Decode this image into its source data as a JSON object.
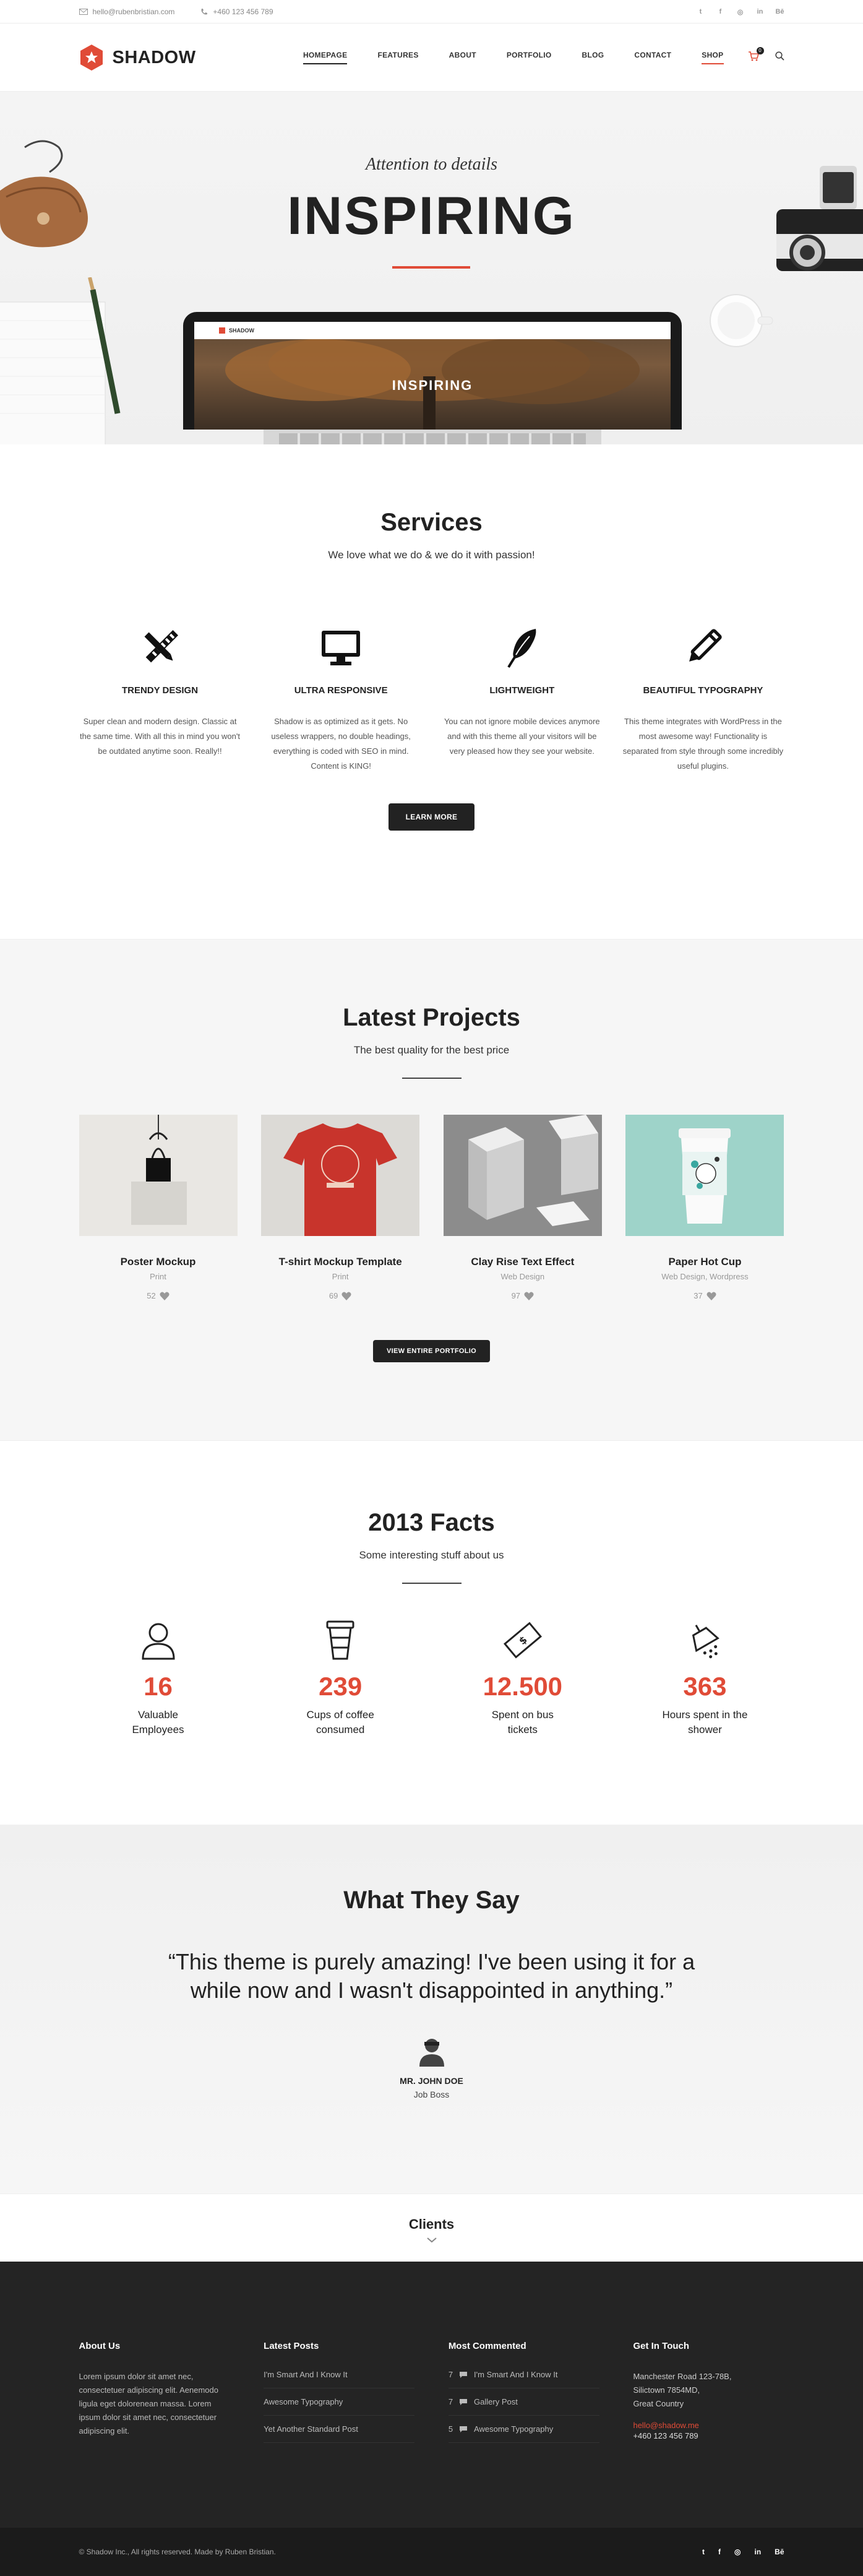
{
  "topbar": {
    "email": "hello@rubenbristian.com",
    "phone": "+460 123 456 789",
    "social": [
      "twitter-icon",
      "facebook-icon",
      "dribbble-icon",
      "linkedin-icon",
      "behance-icon"
    ]
  },
  "header": {
    "logo_text": "SHADOW",
    "nav": [
      "HOMEPAGE",
      "FEATURES",
      "ABOUT",
      "PORTFOLIO",
      "BLOG",
      "CONTACT",
      "SHOP"
    ],
    "cart_count": "0"
  },
  "hero": {
    "kicker": "Attention to details",
    "headline": "INSPIRING",
    "screen_logo": "SHADOW",
    "screen_text": "INSPIRING"
  },
  "services": {
    "title": "Services",
    "subtitle": "We love what we do & we do it with passion!",
    "items": [
      {
        "icon": "pencil-ruler-icon",
        "title": "TRENDY DESIGN",
        "text": "Super clean and modern design. Classic at the same time. With all this in mind you won't be outdated anytime soon. Really!!"
      },
      {
        "icon": "monitor-icon",
        "title": "ULTRA RESPONSIVE",
        "text": "Shadow is as optimized as it gets. No useless wrappers, no double headings, everything is coded with SEO in mind. Content is KING!"
      },
      {
        "icon": "feather-icon",
        "title": "LIGHTWEIGHT",
        "text": "You can not ignore mobile devices anymore and with this theme all your visitors will be very pleased how they see your website."
      },
      {
        "icon": "pen-icon",
        "title": "BEAUTIFUL TYPOGRAPHY",
        "text": "This theme integrates with WordPress in the most awesome way! Functionality is separated from style through some incredibly useful plugins."
      }
    ],
    "button": "LEARN MORE"
  },
  "projects": {
    "title": "Latest Projects",
    "subtitle": "The best quality for the best price",
    "items": [
      {
        "title": "Poster Mockup",
        "category": "Print",
        "likes": "52"
      },
      {
        "title": "T-shirt Mockup Template",
        "category": "Print",
        "likes": "69"
      },
      {
        "title": "Clay Rise Text Effect",
        "category": "Web Design",
        "likes": "97"
      },
      {
        "title": "Paper Hot Cup",
        "category": "Web Design, Wordpress",
        "likes": "37"
      }
    ],
    "button": "VIEW ENTIRE PORTFOLIO"
  },
  "facts": {
    "title": "2013 Facts",
    "subtitle": "Some interesting stuff about us",
    "items": [
      {
        "icon": "user-icon",
        "number": "16",
        "label": "Valuable Employees"
      },
      {
        "icon": "coffee-cup-icon",
        "number": "239",
        "label": "Cups of coffee consumed"
      },
      {
        "icon": "ticket-icon",
        "number": "12.500",
        "label": "Spent on bus tickets"
      },
      {
        "icon": "shower-icon",
        "number": "363",
        "label": "Hours spent in the shower"
      }
    ]
  },
  "testimonial": {
    "title": "What They Say",
    "quote": "“This theme is purely amazing! I've been using it for a while now and I wasn't disappointed in anything.”",
    "name": "MR. JOHN DOE",
    "role": "Job Boss"
  },
  "clients": {
    "title": "Clients"
  },
  "footer": {
    "about": {
      "title": "About Us",
      "text": "Lorem ipsum dolor sit amet nec, consectetuer adipiscing elit. Aenemodo ligula eget dolorenean massa. Lorem ipsum dolor sit amet nec, consectetuer adipiscing elit."
    },
    "posts": {
      "title": "Latest Posts",
      "items": [
        "I'm Smart And I Know It",
        "Awesome Typography",
        "Yet Another Standard Post"
      ]
    },
    "commented": {
      "title": "Most Commented",
      "items": [
        {
          "count": "7",
          "label": "I'm Smart And I Know It"
        },
        {
          "count": "7",
          "label": "Gallery Post"
        },
        {
          "count": "5",
          "label": "Awesome Typography"
        }
      ]
    },
    "touch": {
      "title": "Get In Touch",
      "address1": "Manchester Road 123-78B,",
      "address2": "Silictown 7854MD,",
      "address3": "Great Country",
      "email": "hello@shadow.me",
      "phone": "+460 123 456 789"
    },
    "copyright": "© Shadow Inc., All rights reserved. Made by Ruben Bristian.",
    "social": [
      "twitter-icon",
      "facebook-icon",
      "dribbble-icon",
      "linkedin-icon",
      "behance-icon"
    ]
  },
  "colors": {
    "accent": "#e04b37",
    "dark": "#222222",
    "footer": "#242424"
  }
}
